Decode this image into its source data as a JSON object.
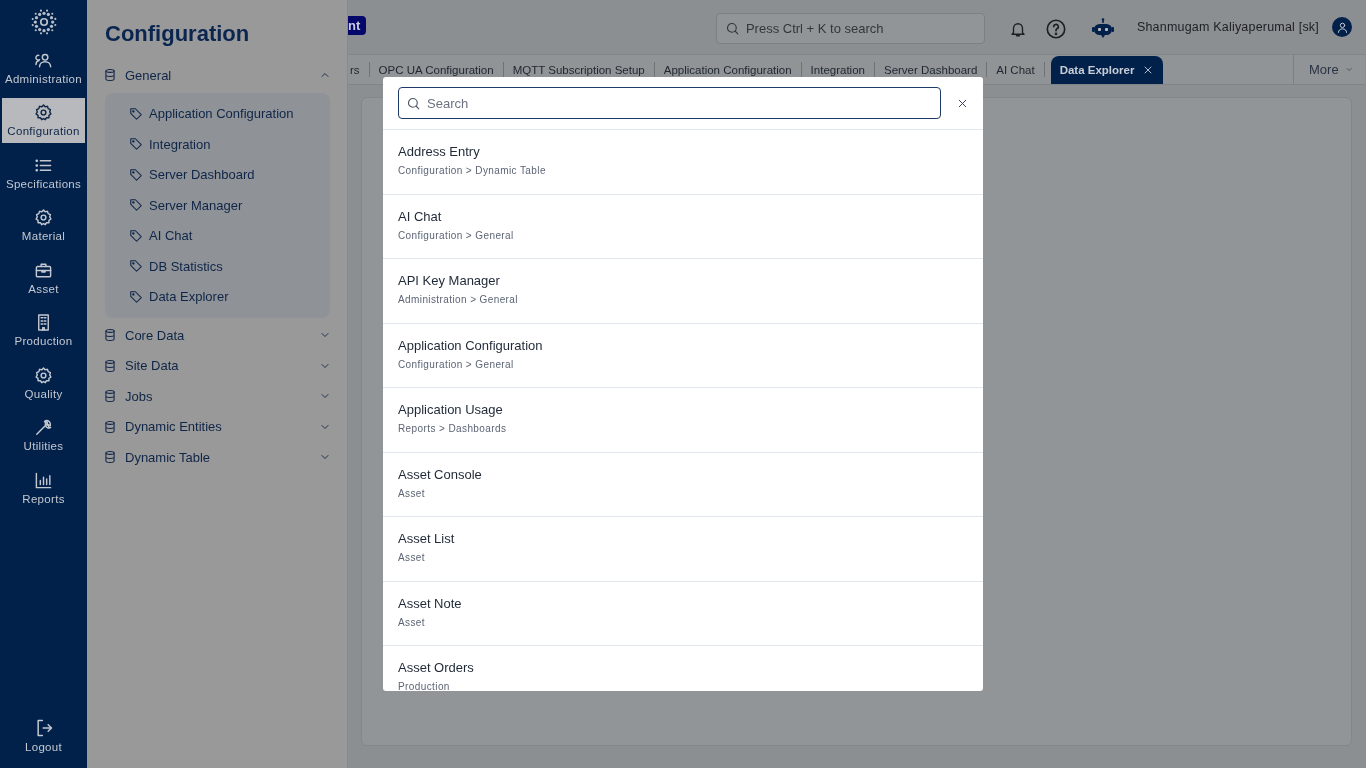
{
  "rail": {
    "items": [
      {
        "label": "Administration",
        "kind": "people",
        "selected": false
      },
      {
        "label": "Configuration",
        "kind": "gear",
        "selected": true
      },
      {
        "label": "Specifications",
        "kind": "list",
        "selected": false
      },
      {
        "label": "Material",
        "kind": "gear",
        "selected": false
      },
      {
        "label": "Asset",
        "kind": "briefcase",
        "selected": false
      },
      {
        "label": "Production",
        "kind": "building",
        "selected": false
      },
      {
        "label": "Quality",
        "kind": "gear",
        "selected": false
      },
      {
        "label": "Utilities",
        "kind": "wrench",
        "selected": false
      },
      {
        "label": "Reports",
        "kind": "chart",
        "selected": false
      }
    ],
    "logout": "Logout"
  },
  "panel": {
    "title": "Configuration",
    "groups": [
      {
        "label": "General",
        "expanded": true,
        "children": [
          {
            "label": "Application Configuration"
          },
          {
            "label": "Integration"
          },
          {
            "label": "Server Dashboard"
          },
          {
            "label": "Server Manager"
          },
          {
            "label": "AI Chat"
          },
          {
            "label": "DB Statistics"
          },
          {
            "label": "Data Explorer"
          }
        ]
      },
      {
        "label": "Core Data",
        "expanded": false
      },
      {
        "label": "Site Data",
        "expanded": false
      },
      {
        "label": "Jobs",
        "expanded": false
      },
      {
        "label": "Dynamic Entities",
        "expanded": false
      },
      {
        "label": "Dynamic Table",
        "expanded": false
      }
    ]
  },
  "header": {
    "brand": "nt",
    "search": {
      "placeholder": "Press Ctrl + K to search"
    },
    "user": "Shanmugam Kaliyaperumal [sk]"
  },
  "tabs": [
    {
      "label": "rs",
      "selected": false
    },
    {
      "label": "OPC UA Configuration",
      "selected": false
    },
    {
      "label": "MQTT Subscription Setup",
      "selected": false
    },
    {
      "label": "Application Configuration",
      "selected": false
    },
    {
      "label": "Integration",
      "selected": false
    },
    {
      "label": "Server Dashboard",
      "selected": false
    },
    {
      "label": "AI Chat",
      "selected": false
    },
    {
      "label": "Data Explorer",
      "selected": true
    }
  ],
  "more": "More",
  "modal": {
    "search": {
      "placeholder": "Search"
    },
    "results": [
      {
        "title": "Address Entry",
        "path": "Configuration > Dynamic Table"
      },
      {
        "title": "AI Chat",
        "path": "Configuration > General"
      },
      {
        "title": "API Key Manager",
        "path": "Administration > General"
      },
      {
        "title": "Application Configuration",
        "path": "Configuration > General"
      },
      {
        "title": "Application Usage",
        "path": "Reports > Dashboards"
      },
      {
        "title": "Asset Console",
        "path": "Asset"
      },
      {
        "title": "Asset List",
        "path": "Asset"
      },
      {
        "title": "Asset Note",
        "path": "Asset"
      },
      {
        "title": "Asset Orders",
        "path": "Production"
      }
    ]
  }
}
